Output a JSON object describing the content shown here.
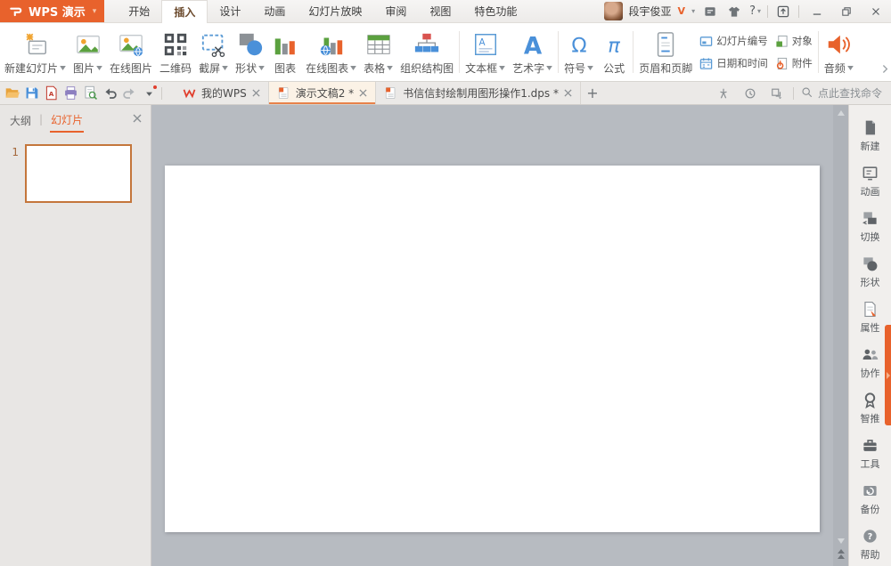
{
  "colors": {
    "accent": "#e8622c",
    "canvas": "#b7bbc1",
    "titlebar_orange": "#e8622c"
  },
  "titlebar": {
    "logo_label": "WPS 演示",
    "menu_tabs": [
      {
        "label": "开始",
        "active": false
      },
      {
        "label": "插入",
        "active": true
      },
      {
        "label": "设计",
        "active": false
      },
      {
        "label": "动画",
        "active": false
      },
      {
        "label": "幻灯片放映",
        "active": false
      },
      {
        "label": "审阅",
        "active": false
      },
      {
        "label": "视图",
        "active": false
      },
      {
        "label": "特色功能",
        "active": false
      }
    ],
    "user": {
      "name": "段宇俊亚",
      "badge": "V"
    }
  },
  "ribbon": {
    "items": [
      {
        "type": "large",
        "label": "新建幻灯片",
        "icon": "new-slide",
        "dropdown": true
      },
      {
        "type": "large",
        "label": "图片",
        "icon": "picture",
        "dropdown": true
      },
      {
        "type": "large",
        "label": "在线图片",
        "icon": "online-picture",
        "dropdown": false
      },
      {
        "type": "large",
        "label": "二维码",
        "icon": "qrcode",
        "dropdown": false
      },
      {
        "type": "large",
        "label": "截屏",
        "icon": "screenshot",
        "dropdown": true
      },
      {
        "type": "large",
        "label": "形状",
        "icon": "shapes",
        "dropdown": true
      },
      {
        "type": "large",
        "label": "图表",
        "icon": "chart",
        "dropdown": false
      },
      {
        "type": "large",
        "label": "在线图表",
        "icon": "online-chart",
        "dropdown": true
      },
      {
        "type": "large",
        "label": "表格",
        "icon": "table",
        "dropdown": true
      },
      {
        "type": "large",
        "label": "组织结构图",
        "icon": "org-chart",
        "dropdown": false
      },
      {
        "type": "divider"
      },
      {
        "type": "large",
        "label": "文本框",
        "icon": "textbox",
        "dropdown": true
      },
      {
        "type": "large",
        "label": "艺术字",
        "icon": "wordart",
        "dropdown": true
      },
      {
        "type": "divider"
      },
      {
        "type": "large",
        "label": "符号",
        "icon": "symbol",
        "dropdown": true
      },
      {
        "type": "large",
        "label": "公式",
        "icon": "formula",
        "dropdown": false
      },
      {
        "type": "divider"
      },
      {
        "type": "large",
        "label": "页眉和页脚",
        "icon": "header-footer",
        "dropdown": false
      },
      {
        "type": "smallgroup",
        "items": [
          {
            "label": "幻灯片编号",
            "icon": "slide-number"
          },
          {
            "label": "日期和时间",
            "icon": "datetime"
          }
        ]
      },
      {
        "type": "smallgroup",
        "items": [
          {
            "label": "对象",
            "icon": "object"
          },
          {
            "label": "附件",
            "icon": "attachment"
          }
        ]
      },
      {
        "type": "divider"
      },
      {
        "type": "large",
        "label": "音频",
        "icon": "audio",
        "dropdown": true
      }
    ]
  },
  "quick_access": [
    {
      "icon": "open-folder"
    },
    {
      "icon": "save"
    },
    {
      "icon": "export-pdf"
    },
    {
      "icon": "print"
    },
    {
      "icon": "print-preview"
    },
    {
      "icon": "undo"
    },
    {
      "icon": "redo"
    },
    {
      "icon": "qat-caret",
      "has_red_dot": true
    }
  ],
  "tabbar": {
    "doc_tabs": [
      {
        "label": "我的WPS",
        "icon": "wps-home",
        "active": false
      },
      {
        "label": "演示文稿2 *",
        "icon": "ppt-doc",
        "active": true
      },
      {
        "label": "书信信封绘制用图形操作1.dps *",
        "icon": "ppt-doc",
        "active": false
      }
    ],
    "new_tab": "+",
    "tools": [
      {
        "icon": "workspace"
      },
      {
        "icon": "history"
      },
      {
        "icon": "tab-list"
      }
    ],
    "search_hint": "点此查找命令"
  },
  "left_panel": {
    "tabs": [
      {
        "label": "大纲",
        "active": false
      },
      {
        "label": "幻灯片",
        "active": true
      }
    ],
    "separator": "|",
    "slides": [
      {
        "number": "1"
      }
    ]
  },
  "right_sidebar": {
    "items": [
      {
        "label": "新建",
        "icon": "new-doc"
      },
      {
        "label": "动画",
        "icon": "animation"
      },
      {
        "label": "切换",
        "icon": "transition"
      },
      {
        "label": "形状",
        "icon": "shape-tool"
      },
      {
        "label": "属性",
        "icon": "properties"
      },
      {
        "label": "协作",
        "icon": "collaboration"
      },
      {
        "label": "智推",
        "icon": "smart-recommend"
      },
      {
        "label": "工具",
        "icon": "tools"
      },
      {
        "label": "备份",
        "icon": "backup"
      },
      {
        "label": "帮助",
        "icon": "help"
      }
    ]
  }
}
